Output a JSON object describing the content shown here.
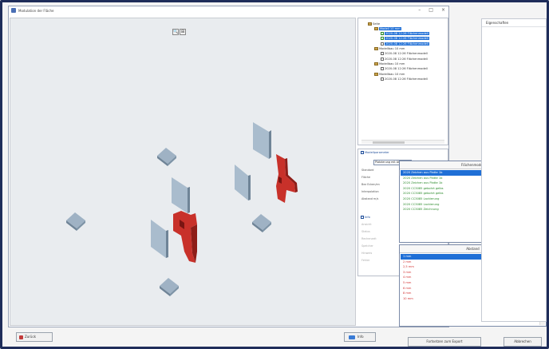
{
  "window": {
    "title": "Modulation der Fläche"
  },
  "viewport": {
    "tool_zoom": "🔍",
    "tool_view": "⊞"
  },
  "tree": {
    "nodes": [
      {
        "label": "Seite",
        "level": 0,
        "kind": "folder",
        "selected": false
      },
      {
        "label": "Modell 10 mm",
        "level": 1,
        "kind": "folder",
        "selected": true
      },
      {
        "label": "2020-08 12:26 Flächenmodell",
        "level": 2,
        "kind": "check",
        "selected": true
      },
      {
        "label": "2020-08 12:26 Flächenmodell",
        "level": 2,
        "kind": "check",
        "selected": true
      },
      {
        "label": "2020-08 12:26 Flächenmodell",
        "level": 2,
        "kind": "leaf",
        "selected": true
      },
      {
        "label": "Modellbau 10 mm",
        "level": 1,
        "kind": "folder",
        "selected": false
      },
      {
        "label": "2020-08 12:26 Flächenmodell",
        "level": 2,
        "kind": "leaf",
        "selected": false
      },
      {
        "label": "2020-08 12:26 Flächenmodell",
        "level": 2,
        "kind": "leaf",
        "selected": false
      },
      {
        "label": "Modellbau 10 mm",
        "level": 1,
        "kind": "folder",
        "selected": false
      },
      {
        "label": "2020-08 12:26 Flächenmodell",
        "level": 2,
        "kind": "leaf",
        "selected": false
      },
      {
        "label": "Modellbau 10 mm",
        "level": 1,
        "kind": "folder",
        "selected": false
      },
      {
        "label": "2020-08 12:26 Flächenmodell",
        "level": 2,
        "kind": "leaf",
        "selected": false
      }
    ]
  },
  "props": {
    "section1": "Modellparameter",
    "dropdown_value": "Platzierung mit Abst. Bg",
    "rows1": [
      "Standard",
      "Fläche",
      "Bez Ecken/en",
      "Interpolation",
      "Abstand m/s"
    ],
    "section2": "Info",
    "rows2": [
      "Ansicht",
      "Status",
      "Rechenzeit",
      "Speicher",
      "Hinweis",
      "Fehler"
    ]
  },
  "popup1": {
    "header": "Flächenmodell",
    "items": [
      {
        "label": "2020 Zeichen aus Platte 1b",
        "color": "#ffffff",
        "selected": true
      },
      {
        "label": "2020 Zeichen aus Platte 1b",
        "color": "#2a8a2a",
        "selected": false
      },
      {
        "label": "2020 Zeichen aus Platte 1b",
        "color": "#2a8a2a",
        "selected": false
      },
      {
        "label": "2020 CC3085 gebohrt gelbs",
        "color": "#2a8a2a",
        "selected": false
      },
      {
        "label": "2020 CC3085 gebohrt gelbs",
        "color": "#2a8a2a",
        "selected": false
      },
      {
        "label": "2020 CC3085 Lackierung",
        "color": "#2a8a2a",
        "selected": false
      },
      {
        "label": "2020 CC3085 Lackierung",
        "color": "#2a8a2a",
        "selected": false
      },
      {
        "label": "2020 CC3085 Zeichnung",
        "color": "#2a8a2a",
        "selected": false
      }
    ]
  },
  "popup2": {
    "header": "Abstand",
    "items": [
      {
        "label": "1 mm",
        "color": "#ffffff",
        "selected": true
      },
      {
        "label": "2 mm",
        "color": "#d22f2f",
        "selected": false
      },
      {
        "label": "2,5 mm",
        "color": "#d22f2f",
        "selected": false
      },
      {
        "label": "3 mm",
        "color": "#d22f2f",
        "selected": false
      },
      {
        "label": "4 mm",
        "color": "#d22f2f",
        "selected": false
      },
      {
        "label": "5 mm",
        "color": "#d22f2f",
        "selected": false
      },
      {
        "label": "6 mm",
        "color": "#d22f2f",
        "selected": false
      },
      {
        "label": "8 mm",
        "color": "#d22f2f",
        "selected": false
      },
      {
        "label": "10 mm",
        "color": "#d22f2f",
        "selected": false
      }
    ]
  },
  "empty_panel": {
    "header": "Eigenschaften"
  },
  "buttons": {
    "back": "Zurück",
    "mid": "Info",
    "next": "Fortsetzen zum Export",
    "close": "Abbrechen"
  },
  "colors": {
    "selection": "#1f6fd6",
    "part_red": "#c8312a",
    "part_blue": "#9fb2c4",
    "frame": "#1f2d5a"
  }
}
